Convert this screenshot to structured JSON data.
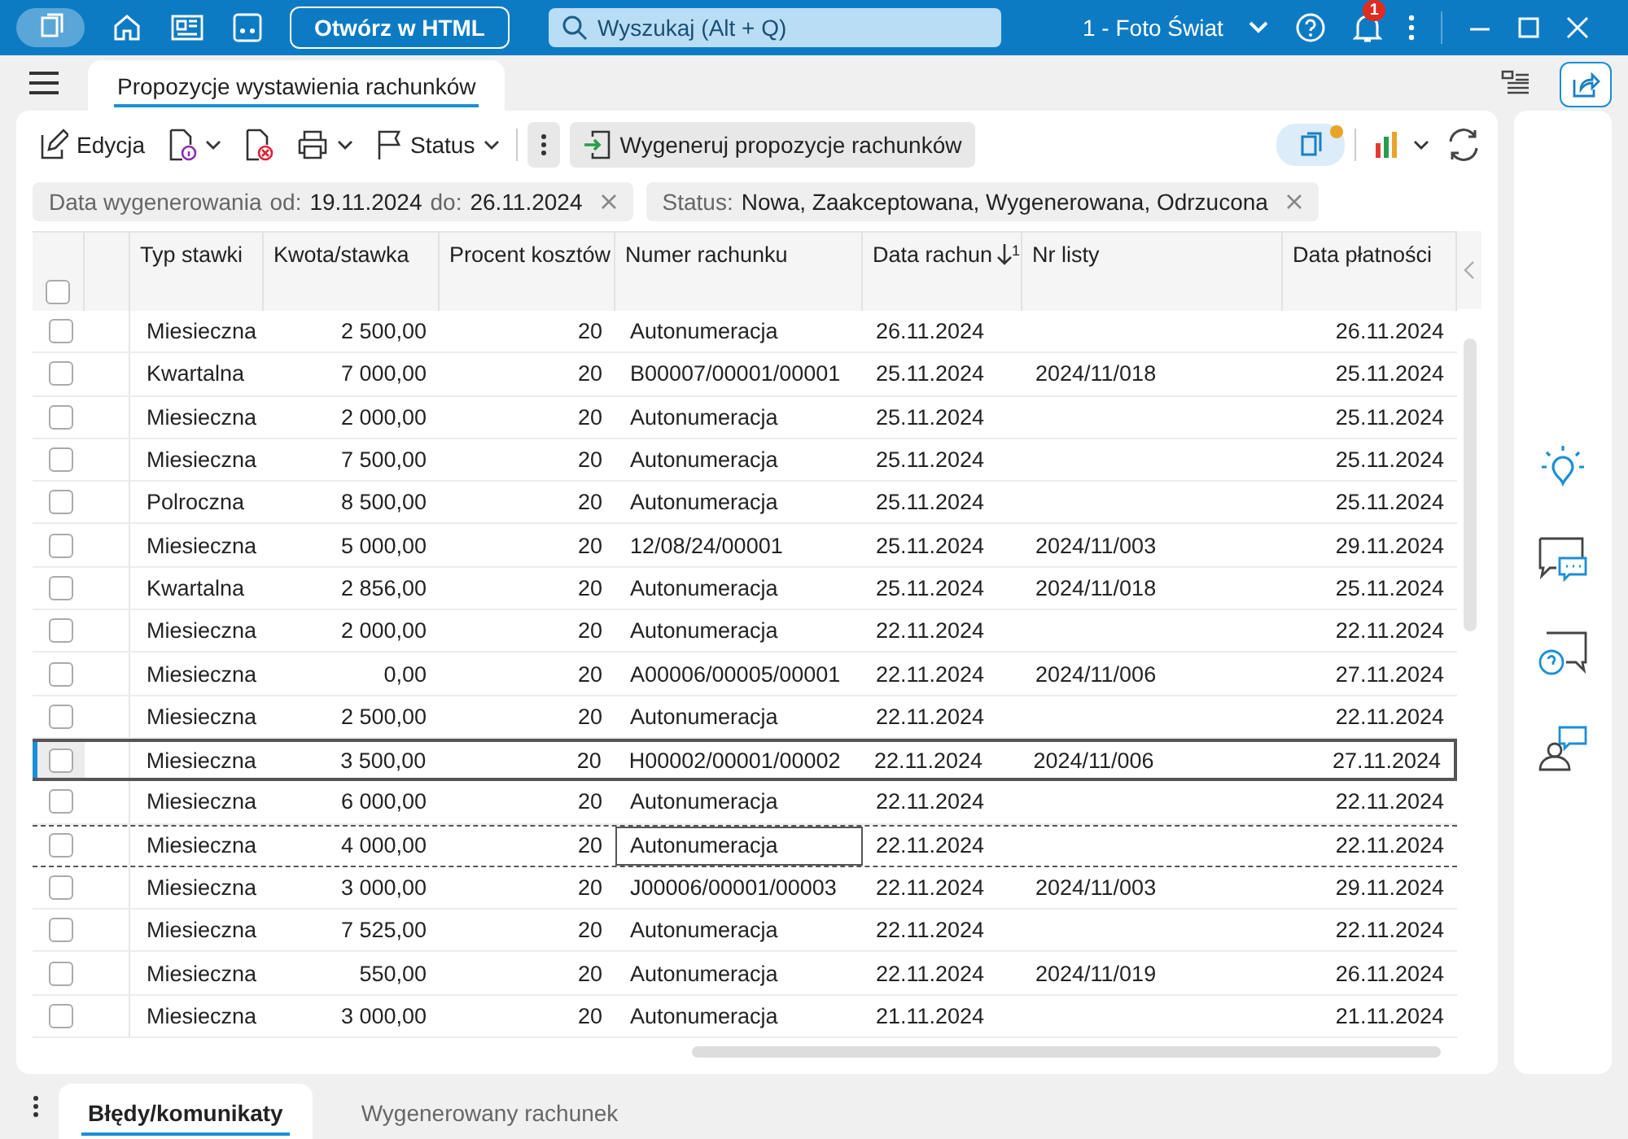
{
  "titlebar": {
    "open_button": "Otwórz w HTML",
    "search": {
      "placeholder": "Wyszukaj (Alt + Q)"
    },
    "company": "1 - Foto Świat",
    "notifications": "1"
  },
  "document_tab": {
    "label": "Propozycje wystawienia rachunków",
    "selected": true
  },
  "toolbar": {
    "edit": "Edycja",
    "status": "Status",
    "generate": "Wygeneruj propozycje rachunków"
  },
  "filters": [
    {
      "label": "Data wygenerowania",
      "parts": [
        {
          "key": "od:",
          "value": "19.11.2024"
        },
        {
          "key": "do:",
          "value": "26.11.2024"
        }
      ]
    },
    {
      "label": "Status:",
      "parts": [
        {
          "value": "Nowa, Zaakceptowana, Wygenerowana, Odrzucona"
        }
      ]
    }
  ],
  "table": {
    "select_all_checked": false,
    "columns": [
      {
        "label": "Typ stawki"
      },
      {
        "label": "Kwota/stawka"
      },
      {
        "label": "Procent kosztów"
      },
      {
        "label": "Numer rachunku"
      },
      {
        "label": "Data rachun",
        "sort_order": "1"
      },
      {
        "label": "Nr listy"
      },
      {
        "label": "Data płatności"
      }
    ],
    "rows": [
      {
        "checked": false,
        "selected": false,
        "focused": false,
        "cells": [
          "Miesieczna",
          "2 500,00",
          "20",
          "Autonumeracja",
          "26.11.2024",
          "",
          "26.11.2024"
        ]
      },
      {
        "checked": false,
        "selected": false,
        "focused": false,
        "cells": [
          "Kwartalna",
          "7 000,00",
          "20",
          "B00007/00001/00001",
          "25.11.2024",
          "2024/11/018",
          "25.11.2024"
        ]
      },
      {
        "checked": false,
        "selected": false,
        "focused": false,
        "cells": [
          "Miesieczna",
          "2 000,00",
          "20",
          "Autonumeracja",
          "25.11.2024",
          "",
          "25.11.2024"
        ]
      },
      {
        "checked": false,
        "selected": false,
        "focused": false,
        "cells": [
          "Miesieczna",
          "7 500,00",
          "20",
          "Autonumeracja",
          "25.11.2024",
          "",
          "25.11.2024"
        ]
      },
      {
        "checked": false,
        "selected": false,
        "focused": false,
        "cells": [
          "Polroczna",
          "8 500,00",
          "20",
          "Autonumeracja",
          "25.11.2024",
          "",
          "25.11.2024"
        ]
      },
      {
        "checked": false,
        "selected": false,
        "focused": false,
        "cells": [
          "Miesieczna",
          "5 000,00",
          "20",
          "12/08/24/00001",
          "25.11.2024",
          "2024/11/003",
          "29.11.2024"
        ]
      },
      {
        "checked": false,
        "selected": false,
        "focused": false,
        "cells": [
          "Kwartalna",
          "2 856,00",
          "20",
          "Autonumeracja",
          "25.11.2024",
          "2024/11/018",
          "25.11.2024"
        ]
      },
      {
        "checked": false,
        "selected": false,
        "focused": false,
        "cells": [
          "Miesieczna",
          "2 000,00",
          "20",
          "Autonumeracja",
          "22.11.2024",
          "",
          "22.11.2024"
        ]
      },
      {
        "checked": false,
        "selected": false,
        "focused": false,
        "cells": [
          "Miesieczna",
          "0,00",
          "20",
          "A00006/00005/00001",
          "22.11.2024",
          "2024/11/006",
          "27.11.2024"
        ]
      },
      {
        "checked": false,
        "selected": false,
        "focused": false,
        "cells": [
          "Miesieczna",
          "2 500,00",
          "20",
          "Autonumeracja",
          "22.11.2024",
          "",
          "22.11.2024"
        ]
      },
      {
        "checked": false,
        "selected": true,
        "focused": false,
        "cells": [
          "Miesieczna",
          "3 500,00",
          "20",
          "H00002/00001/00002",
          "22.11.2024",
          "2024/11/006",
          "27.11.2024"
        ]
      },
      {
        "checked": false,
        "selected": false,
        "focused": false,
        "cells": [
          "Miesieczna",
          "6 000,00",
          "20",
          "Autonumeracja",
          "22.11.2024",
          "",
          "22.11.2024"
        ]
      },
      {
        "checked": false,
        "selected": false,
        "focused": true,
        "cells": [
          "Miesieczna",
          "4 000,00",
          "20",
          "Autonumeracja",
          "22.11.2024",
          "",
          "22.11.2024"
        ]
      },
      {
        "checked": false,
        "selected": false,
        "focused": false,
        "cells": [
          "Miesieczna",
          "3 000,00",
          "20",
          "J00006/00001/00003",
          "22.11.2024",
          "2024/11/003",
          "29.11.2024"
        ]
      },
      {
        "checked": false,
        "selected": false,
        "focused": false,
        "cells": [
          "Miesieczna",
          "7 525,00",
          "20",
          "Autonumeracja",
          "22.11.2024",
          "",
          "22.11.2024"
        ]
      },
      {
        "checked": false,
        "selected": false,
        "focused": false,
        "cells": [
          "Miesieczna",
          "550,00",
          "20",
          "Autonumeracja",
          "22.11.2024",
          "2024/11/019",
          "26.11.2024"
        ]
      },
      {
        "checked": false,
        "selected": false,
        "focused": false,
        "cells": [
          "Miesieczna",
          "3 000,00",
          "20",
          "Autonumeracja",
          "21.11.2024",
          "",
          "21.11.2024"
        ]
      }
    ]
  },
  "bottom_tabs": [
    {
      "label": "Błędy/komunikaty",
      "selected": true
    },
    {
      "label": "Wygenerowany rachunek",
      "selected": false
    }
  ]
}
